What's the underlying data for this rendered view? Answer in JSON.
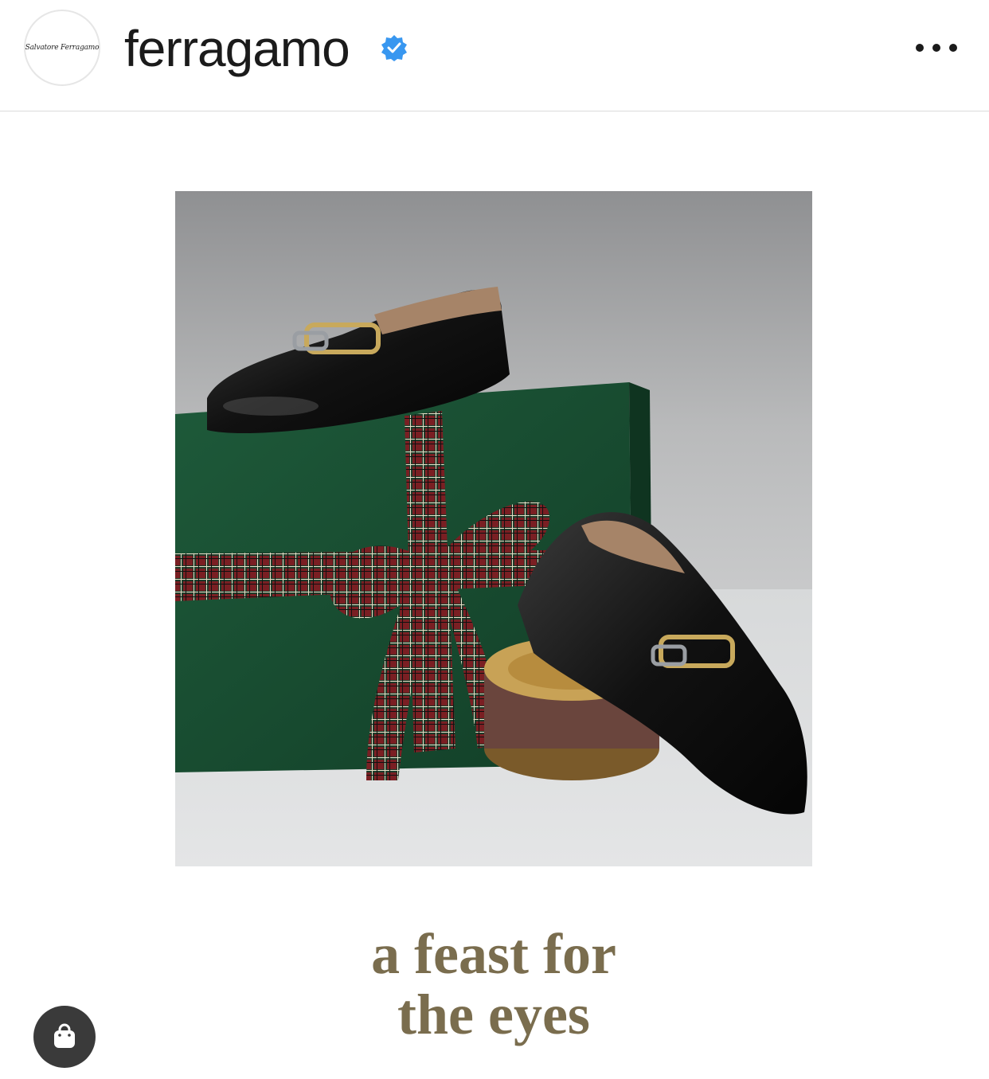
{
  "header": {
    "avatar_text": "Salvatore Ferragamo",
    "username": "ferragamo",
    "verified_icon": "verified-badge-icon",
    "more_icon": "more-options-icon",
    "accent_color": "#3897f0"
  },
  "post": {
    "caption_line1": "a feast for",
    "caption_line2": "the eyes",
    "caption_color": "#7a6d4e"
  },
  "shop": {
    "icon": "shopping-bag-icon"
  }
}
